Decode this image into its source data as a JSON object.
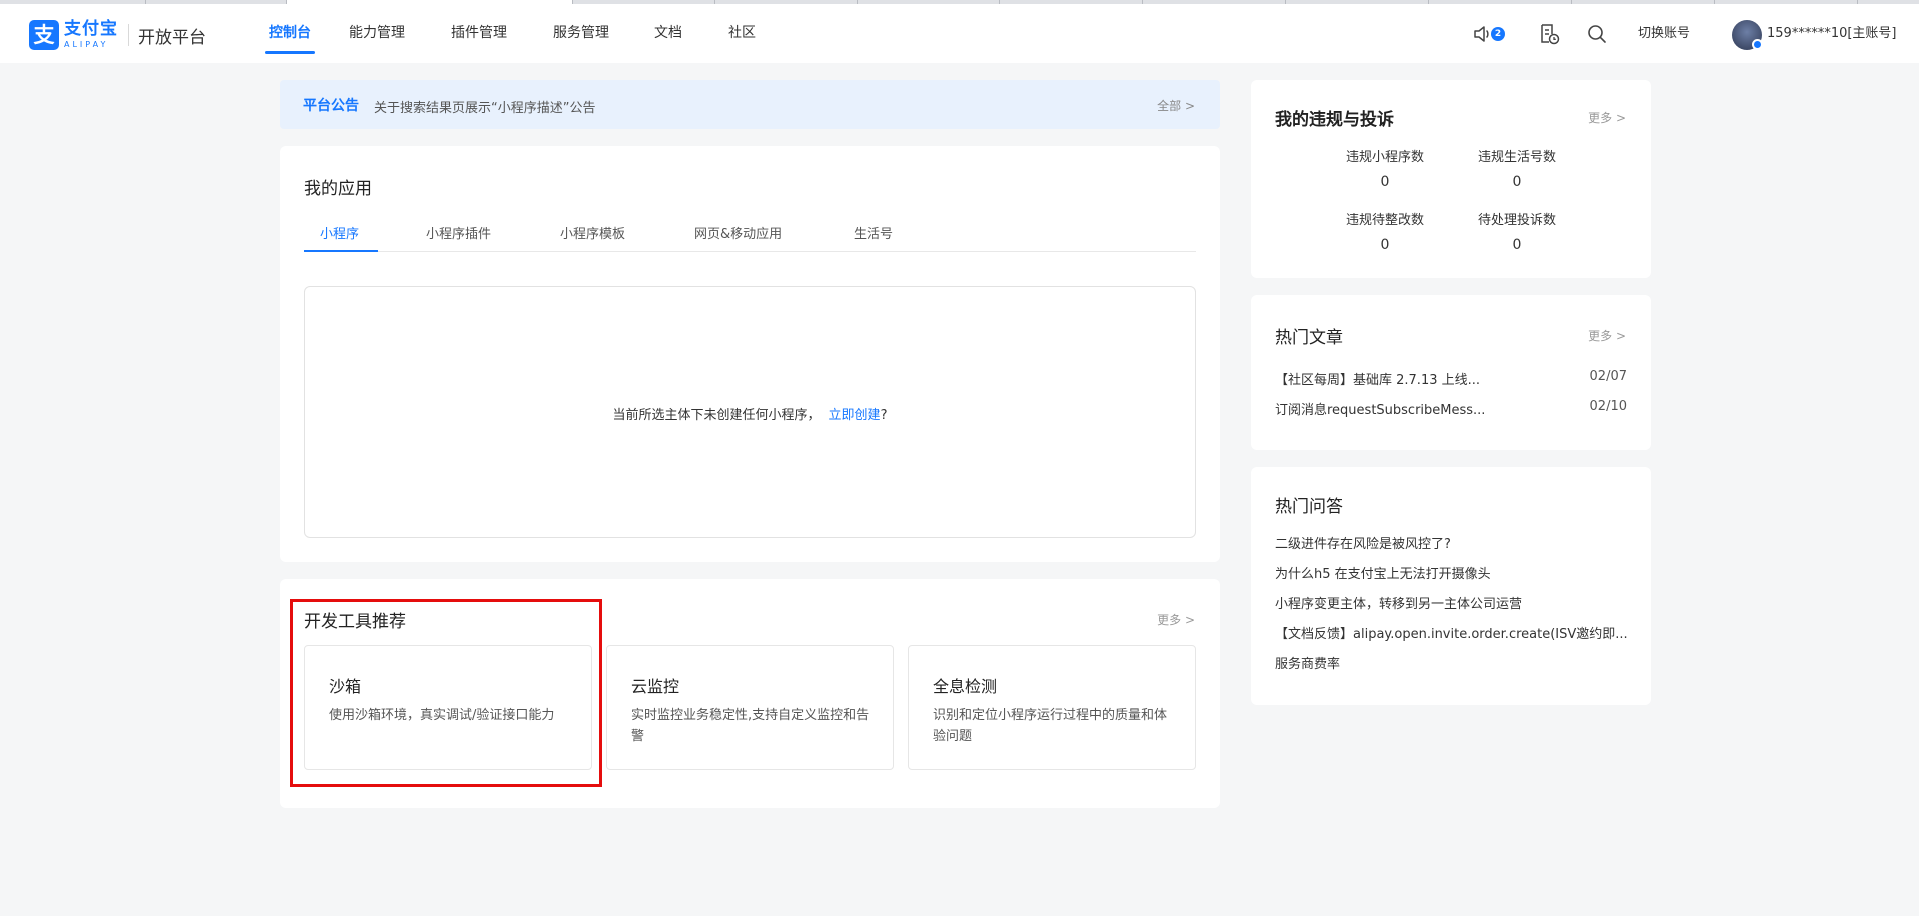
{
  "header": {
    "logo_cn": "支付宝",
    "logo_en": "ALIPAY",
    "platform": "开放平台",
    "nav": [
      {
        "label": "控制台",
        "active": true
      },
      {
        "label": "能力管理",
        "active": false
      },
      {
        "label": "插件管理",
        "active": false
      },
      {
        "label": "服务管理",
        "active": false
      },
      {
        "label": "文档",
        "active": false
      },
      {
        "label": "社区",
        "active": false
      }
    ],
    "notification_count": "2",
    "switch_account": "切换账号",
    "account": "159******10[主账号]",
    "accent_color": "#1677ff"
  },
  "notice": {
    "tag": "平台公告",
    "text": "关于搜索结果页展示“小程序描述”公告",
    "all_link": "全部 >"
  },
  "my_apps": {
    "title": "我的应用",
    "tabs": [
      {
        "label": "小程序",
        "active": true
      },
      {
        "label": "小程序插件",
        "active": false
      },
      {
        "label": "小程序模板",
        "active": false
      },
      {
        "label": "网页&移动应用",
        "active": false
      },
      {
        "label": "生活号",
        "active": false
      }
    ],
    "empty_text": "当前所选主体下未创建任何小程序，",
    "create_link": "立即创建",
    "question_mark": "?"
  },
  "dev_tools": {
    "title": "开发工具推荐",
    "more": "更多 >",
    "tools": [
      {
        "title": "沙箱",
        "desc": "使用沙箱环境，真实调试/验证接口能力"
      },
      {
        "title": "云监控",
        "desc": "实时监控业务稳定性,支持自定义监控和告警"
      },
      {
        "title": "全息检测",
        "desc": "识别和定位小程序运行过程中的质量和体验问题"
      }
    ],
    "highlight_color": "#e50d0d"
  },
  "violations": {
    "title": "我的违规与投诉",
    "more": "更多 >",
    "stats": [
      {
        "label": "违规小程序数",
        "value": "0"
      },
      {
        "label": "违规生活号数",
        "value": "0"
      },
      {
        "label": "违规待整改数",
        "value": "0"
      },
      {
        "label": "待处理投诉数",
        "value": "0"
      }
    ]
  },
  "hot_articles": {
    "title": "热门文章",
    "more": "更多 >",
    "items": [
      {
        "title": "【社区每周】基础库 2.7.13 上线...",
        "date": "02/07"
      },
      {
        "title": "订阅消息requestSubscribeMess...",
        "date": "02/10"
      }
    ]
  },
  "hot_questions": {
    "title": "热门问答",
    "items": [
      "二级进件存在风险是被风控了?",
      "为什么h5 在支付宝上无法打开摄像头",
      "小程序变更主体，转移到另一主体公司运营",
      "【文档反馈】alipay.open.invite.order.create(ISV邀约即...",
      "服务商费率"
    ]
  }
}
